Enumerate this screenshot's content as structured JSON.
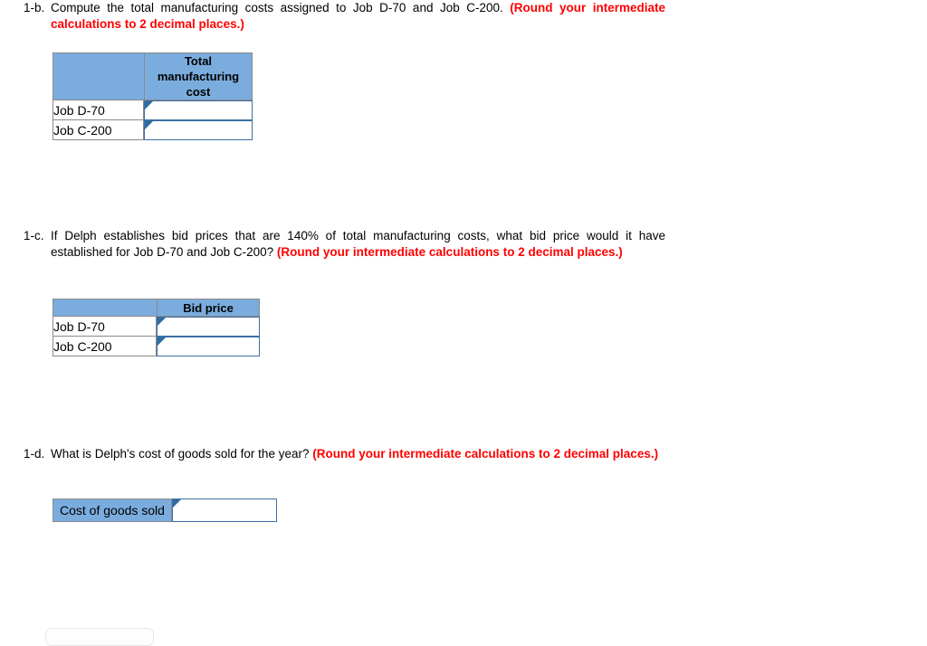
{
  "page": {
    "background_color": "#ffffff",
    "hint_color": "#FF0000",
    "header_fill_color": "#7BACDE",
    "input_border_color": "#3C6FA5",
    "marker_color": "#2E6CA4"
  },
  "questions": [
    {
      "number": "1-b.",
      "text": "Compute the total manufacturing costs assigned to Job D-70 and Job C-200. ",
      "hint": "(Round your intermediate calculations to 2 decimal places.)"
    },
    {
      "number": "1-c.",
      "text": "If Delph establishes bid prices that are 140% of total manufacturing costs, what bid price would it have established for Job D-70 and Job C-200? ",
      "hint": "(Round your intermediate calculations to 2 decimal places.)"
    },
    {
      "number": "1-d.",
      "text": "What is Delph's cost of goods sold for the year? ",
      "hint": "(Round your intermediate calculations to 2 decimal places.)"
    }
  ],
  "table_1b": {
    "corner_header": "",
    "column_header": "Total manufacturing cost",
    "rows": [
      {
        "label": "Job D-70",
        "value": ""
      },
      {
        "label": "Job C-200",
        "value": ""
      }
    ]
  },
  "table_1c": {
    "corner_header": "",
    "column_header": "Bid price",
    "rows": [
      {
        "label": "Job D-70",
        "value": ""
      },
      {
        "label": "Job C-200",
        "value": ""
      }
    ]
  },
  "table_1d": {
    "label": "Cost of goods sold",
    "value": ""
  }
}
